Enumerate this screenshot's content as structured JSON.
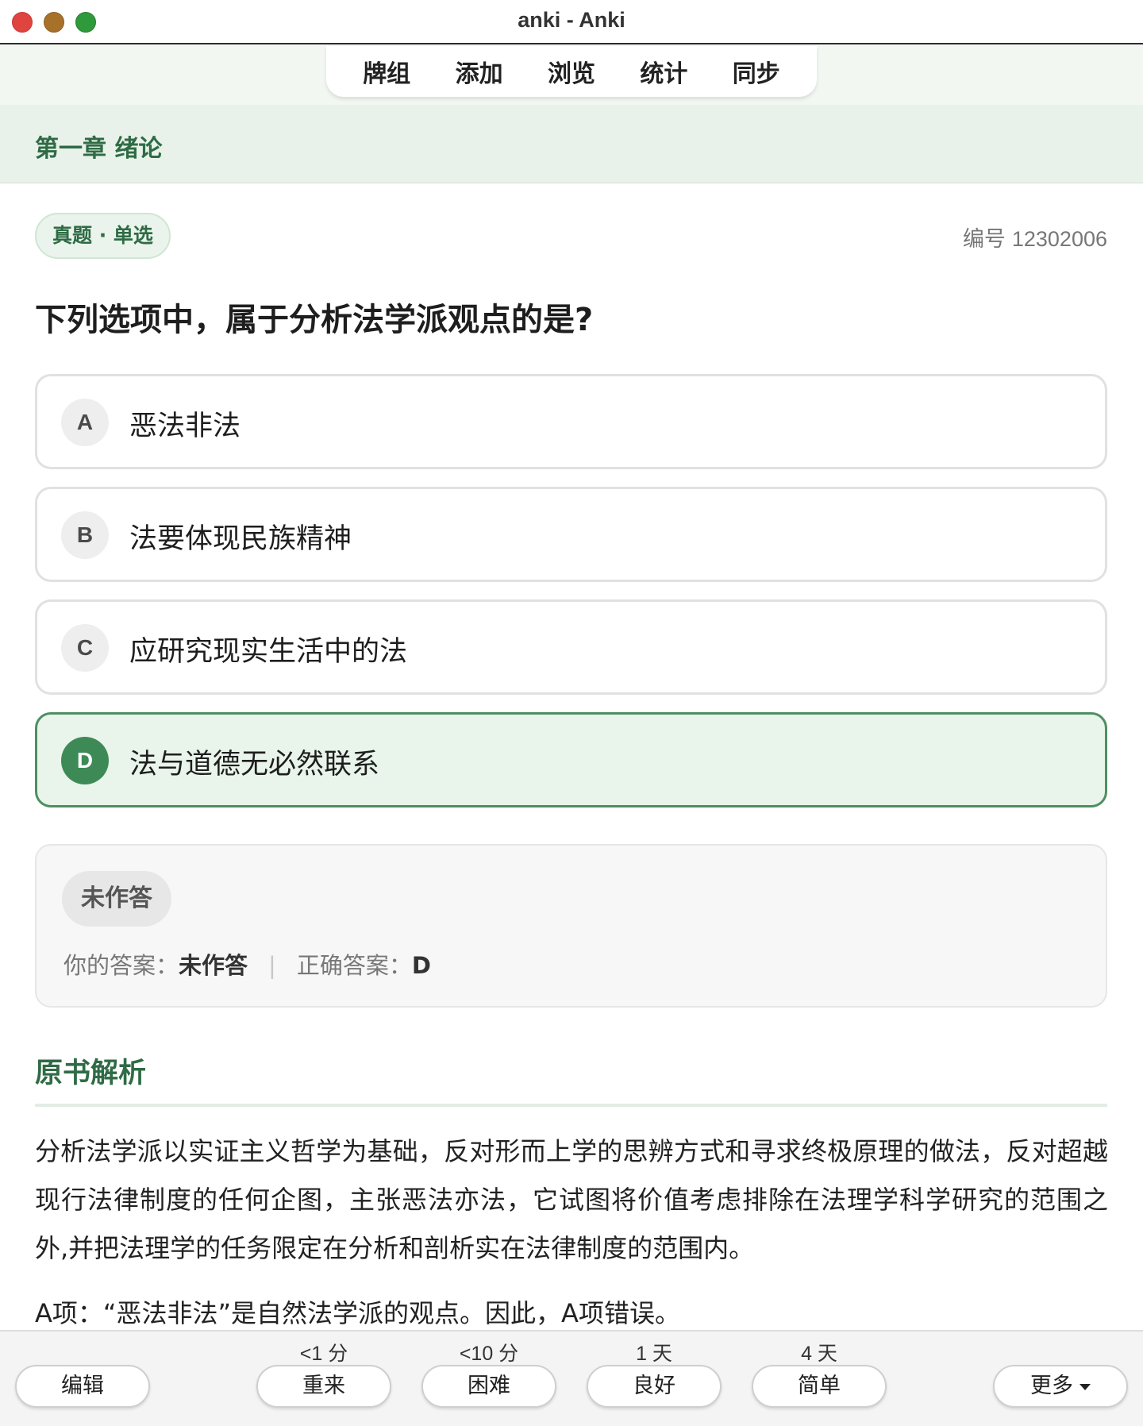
{
  "window": {
    "title": "anki - Anki"
  },
  "nav": {
    "items": [
      "牌组",
      "添加",
      "浏览",
      "统计",
      "同步"
    ]
  },
  "chapter": {
    "title": "第一章 绪论"
  },
  "meta": {
    "tag": "真题 · 单选",
    "id_label": "编号",
    "id_value": "12302006"
  },
  "question": {
    "text": "下列选项中，属于分析法学派观点的是?"
  },
  "options": [
    {
      "letter": "A",
      "text": "恶法非法"
    },
    {
      "letter": "B",
      "text": "法要体现民族精神"
    },
    {
      "letter": "C",
      "text": "应研究现实生活中的法"
    },
    {
      "letter": "D",
      "text": "法与道德无必然联系"
    }
  ],
  "result": {
    "badge": "未作答",
    "your_label": "你的答案：",
    "your_value": "未作答",
    "separator": "|",
    "correct_label": "正确答案：",
    "correct_value": "D"
  },
  "analysis": {
    "title": "原书解析",
    "body": "分析法学派以实证主义哲学为基础，反对形而上学的思辨方式和寻求终极原理的做法，反对超越现行法律制度的任何企图，主张恶法亦法，它试图将价值考虑排除在法理学科学研究的范围之外,并把法理学的任务限定在分析和剖析实在法律制度的范围内。",
    "item_a": "A项：“恶法非法”是自然法学派的观点。因此，A项错误。"
  },
  "footer": {
    "edit": "编辑",
    "more": "更多",
    "answers": [
      {
        "interval": "<1 分",
        "label": "重来"
      },
      {
        "interval": "<10 分",
        "label": "困难"
      },
      {
        "interval": "1 天",
        "label": "良好"
      },
      {
        "interval": "4 天",
        "label": "简单"
      }
    ]
  },
  "colors": {
    "accent_green": "#2f6b45",
    "correct_fill": "#3e8a57",
    "chapter_bg": "#e8f2ea"
  }
}
